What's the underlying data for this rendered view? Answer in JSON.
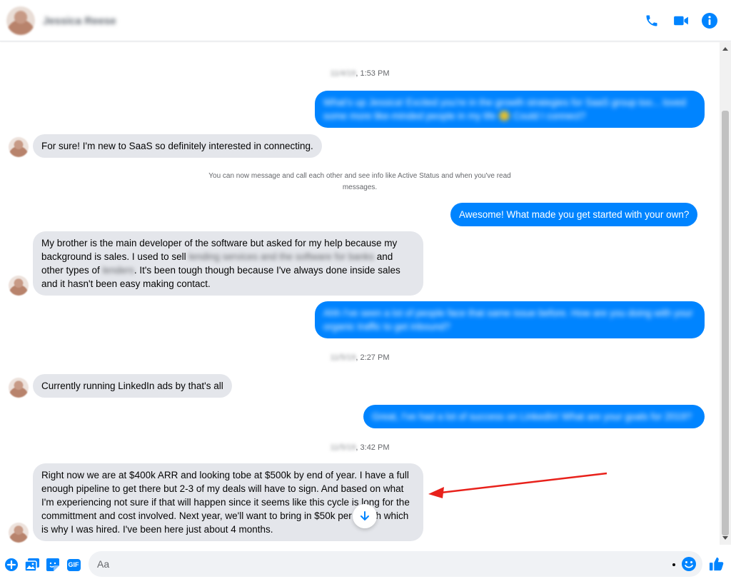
{
  "header": {
    "contact_name": "Jessica Reese",
    "icons": {
      "call": "phone-icon",
      "video": "video-camera-icon",
      "info": "info-icon"
    }
  },
  "colors": {
    "accent": "#0084ff",
    "incoming_bubble": "#e4e6eb",
    "annotation_arrow": "#e8211b"
  },
  "conversation": {
    "timestamp_1": {
      "date": "11/4/19",
      "time": ", 1:53 PM"
    },
    "msg_out_1": "What's up Jessica! Excited you're in the growth strategies for SaaS group too... loved some more like-minded people in my life 🙂 Could I connect?",
    "msg_in_1": "For sure! I'm new to SaaS so definitely interested in connecting.",
    "system_notice": "You can now message and call each other and see info like Active Status and when you've read messages.",
    "msg_out_2": "Awesome! What made you get started with your own?",
    "msg_in_2": {
      "part1": "My brother is the main developer of the software but asked for my help because my background is sales. I used to sell ",
      "redacted1": "lending services and the software for banks",
      "part2": " and other types of ",
      "redacted2": "lenders",
      "part3": ". It's been tough though because I've always done inside sales and it hasn't been easy making contact."
    },
    "msg_out_3": "Ahh I've seen a lot of people face that same issue before. How are you doing with your organic traffic to get inbound?",
    "timestamp_2": {
      "date": "11/5/19",
      "time": ", 2:27 PM"
    },
    "msg_in_3": "Currently running LinkedIn ads by that's all",
    "msg_out_4": "Great, I've had a lot of success on LinkedIn! What are your goals for 2019?",
    "timestamp_3": {
      "date": "11/5/19",
      "time": ", 3:42 PM"
    },
    "msg_in_4": "Right now we are at $400k ARR and looking tobe at $500k by end of year. I have a full enough pipeline to get there but 2-3 of my deals will have to sign. And based on what I'm experiencing not sure if that will happen since it seems like this cycle is long for the committment and cost involved. Next year, we'll want to bring in $50k per month which is why I was hired.  I've  been here just about 4 months."
  },
  "scroll_down_icon": "arrow-down-icon",
  "composer": {
    "placeholder": "Aa",
    "icons": [
      "plus-circle-icon",
      "photo-icon",
      "sticker-icon",
      "gif-icon",
      "emoji-icon",
      "thumbs-up-icon"
    ],
    "gif_label": "GIF"
  }
}
